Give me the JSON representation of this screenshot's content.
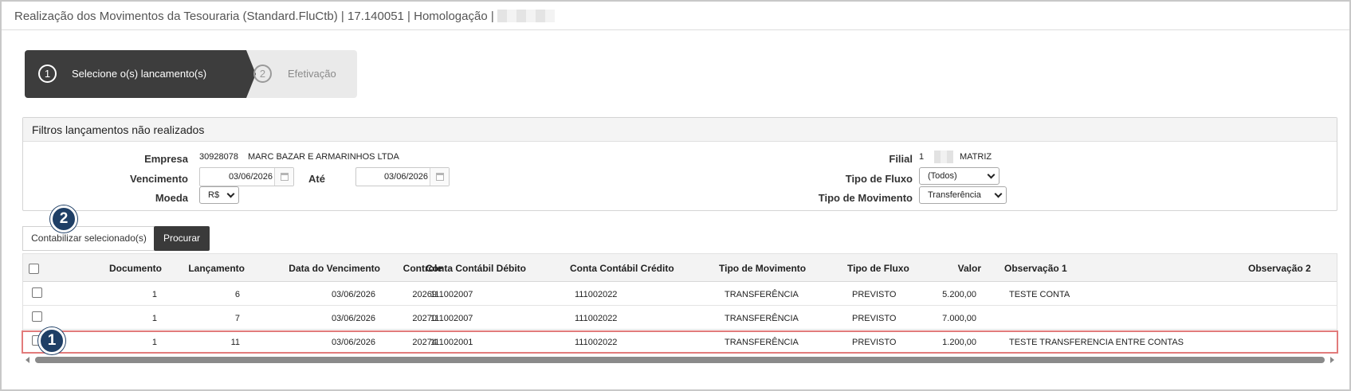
{
  "window": {
    "title": "Realização dos Movimentos da Tesouraria (Standard.FluCtb) | 17.140051 | Homologação |"
  },
  "wizard": {
    "steps": [
      {
        "number": "1",
        "label": "Selecione o(s) lancamento(s)",
        "active": true
      },
      {
        "number": "2",
        "label": "Efetivação",
        "active": false
      }
    ]
  },
  "filters": {
    "title": "Filtros lançamentos não realizados",
    "empresa_label": "Empresa",
    "empresa_code": "30928078",
    "empresa_name": "MARC BAZAR E ARMARINHOS LTDA",
    "vencimento_label": "Vencimento",
    "vencimento_value": "03/06/2026",
    "ate_label": "Até",
    "ate_value": "03/06/2026",
    "moeda_label": "Moeda",
    "moeda_value": "R$",
    "filial_label": "Filial",
    "filial_code": "1",
    "filial_name": "MATRIZ",
    "tipo_fluxo_label": "Tipo de Fluxo",
    "tipo_fluxo_value": "(Todos)",
    "tipo_movimento_label": "Tipo de Movimento",
    "tipo_movimento_value": "Transferência"
  },
  "actions": {
    "contabilizar_label": "Contabilizar selecionado(s)",
    "procurar_label": "Procurar"
  },
  "callouts": {
    "one": "1",
    "two": "2"
  },
  "table": {
    "headers": {
      "documento": "Documento",
      "lancamento": "Lançamento",
      "data_vencimento": "Data do Vencimento",
      "controle": "Controle",
      "conta_debito": "Conta Contábil Débito",
      "conta_credito": "Conta Contábil Crédito",
      "tipo_movimento": "Tipo de Movimento",
      "tipo_fluxo": "Tipo de Fluxo",
      "valor": "Valor",
      "obs1": "Observação 1",
      "obs2": "Observação 2"
    },
    "rows": [
      {
        "documento": "1",
        "lancamento": "6",
        "data_vencimento": "03/06/2026",
        "controle": "20269",
        "conta_debito": "111002007",
        "conta_credito": "111002022",
        "tipo_movimento": "TRANSFERÊNCIA",
        "tipo_fluxo": "PREVISTO",
        "valor": "5.200,00",
        "obs1": "TESTE CONTA",
        "obs2": ""
      },
      {
        "documento": "1",
        "lancamento": "7",
        "data_vencimento": "03/06/2026",
        "controle": "20270",
        "conta_debito": "111002007",
        "conta_credito": "111002022",
        "tipo_movimento": "TRANSFERÊNCIA",
        "tipo_fluxo": "PREVISTO",
        "valor": "7.000,00",
        "obs1": "",
        "obs2": ""
      },
      {
        "documento": "1",
        "lancamento": "11",
        "data_vencimento": "03/06/2026",
        "controle": "20274",
        "conta_debito": "111002001",
        "conta_credito": "111002022",
        "tipo_movimento": "TRANSFERÊNCIA",
        "tipo_fluxo": "PREVISTO",
        "valor": "1.200,00",
        "obs1": "TESTE TRANSFERENCIA ENTRE CONTAS",
        "obs2": ""
      }
    ]
  },
  "colors": {
    "wizard_active": "#3d3d3d",
    "callout_badge": "#1f3f66",
    "highlight_border": "#e27b7b"
  }
}
